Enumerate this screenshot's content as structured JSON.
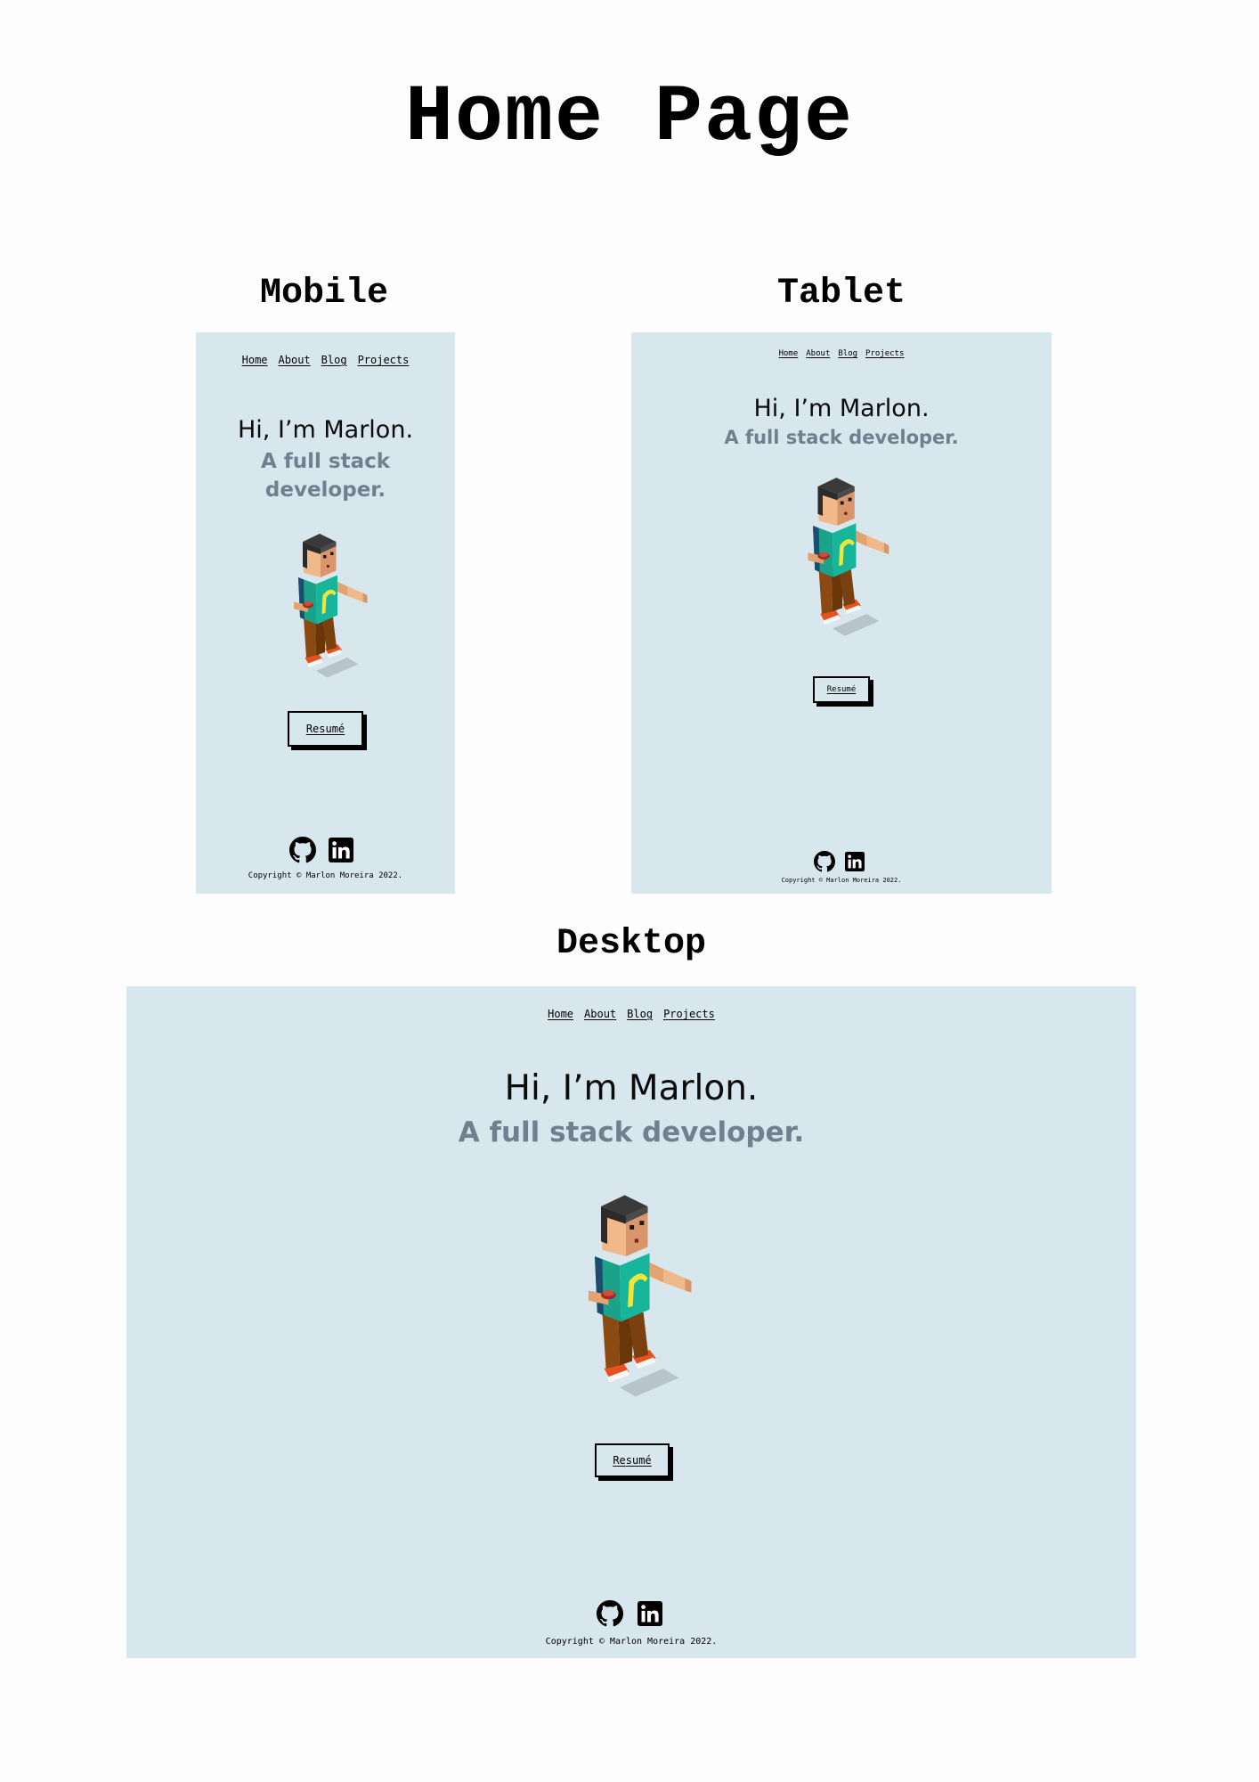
{
  "page_title": "Home Page",
  "frames": {
    "mobile": {
      "label": "Mobile",
      "nav": [
        "Home",
        "About",
        "Blog",
        "Projects"
      ],
      "greeting": "Hi, I’m Marlon.",
      "subtitle_line1": "A full stack",
      "subtitle_line2": "developer.",
      "resume_label": "Resumé",
      "copyright": "Copyright © Marlon Moreira 2022."
    },
    "tablet": {
      "label": "Tablet",
      "nav": [
        "Home",
        "About",
        "Blog",
        "Projects"
      ],
      "greeting": "Hi, I’m Marlon.",
      "subtitle": "A full stack developer.",
      "resume_label": "Resumé",
      "copyright": "Copyright © Marlon Moreira 2022."
    },
    "desktop": {
      "label": "Desktop",
      "nav": [
        "Home",
        "About",
        "Blog",
        "Projects"
      ],
      "greeting": "Hi, I’m Marlon.",
      "subtitle": "A full stack developer.",
      "resume_label": "Resumé",
      "copyright": "Copyright © Marlon Moreira 2022."
    }
  },
  "icons": {
    "social": [
      "github-icon",
      "linkedin-icon"
    ],
    "avatar": "isometric-character-illustration"
  },
  "colors": {
    "frame_background": "#d8e6ed",
    "subtitle": "#71808e",
    "text": "#000000"
  }
}
